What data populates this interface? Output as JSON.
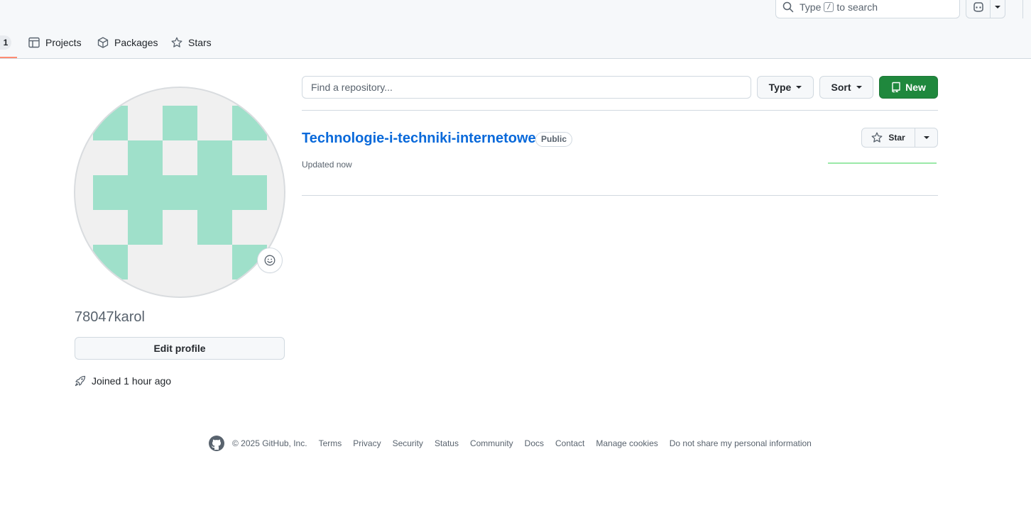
{
  "header": {
    "search": {
      "prefix": "Type",
      "key": "/",
      "suffix": "to search"
    },
    "copilot_icon": "copilot-icon",
    "tabs": {
      "count_badge": "1",
      "items": [
        {
          "label": "Projects",
          "icon": "table-icon"
        },
        {
          "label": "Packages",
          "icon": "package-icon"
        },
        {
          "label": "Stars",
          "icon": "star-icon"
        }
      ]
    }
  },
  "profile": {
    "username": "78047karol",
    "edit_label": "Edit profile",
    "joined": "Joined 1 hour ago",
    "avatar_color": "#9fe0ca"
  },
  "repos": {
    "find_placeholder": "Find a repository...",
    "type_label": "Type",
    "sort_label": "Sort",
    "new_label": "New",
    "list": [
      {
        "name": "Technologie-i-techniki-internetowe",
        "visibility": "Public",
        "updated": "Updated now",
        "star_label": "Star"
      }
    ]
  },
  "footer": {
    "copyright": "© 2025 GitHub, Inc.",
    "links": [
      "Terms",
      "Privacy",
      "Security",
      "Status",
      "Community",
      "Docs",
      "Contact",
      "Manage cookies",
      "Do not share my personal information"
    ]
  },
  "colors": {
    "accent": "#0969da",
    "primary_button": "#1f883d",
    "tab_underline": "#fd8c73"
  }
}
